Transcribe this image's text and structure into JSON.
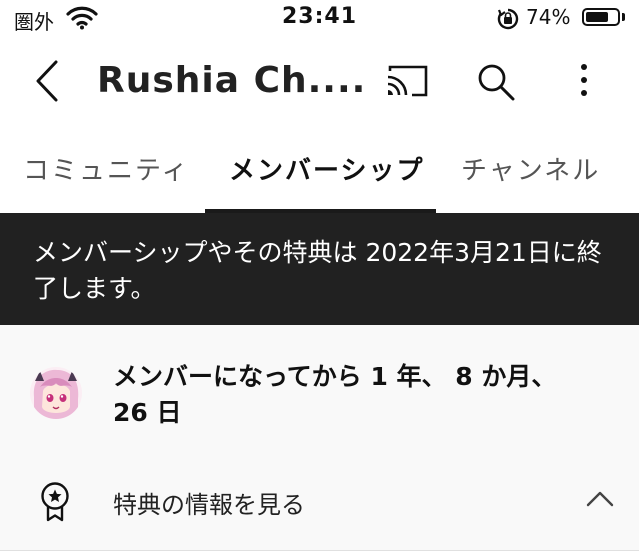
{
  "status_bar": {
    "carrier": "圏外",
    "time": "23:41",
    "battery_percent": "74%",
    "battery_level": 0.74
  },
  "header": {
    "title": "Rushia Ch....",
    "icons": [
      "back-chevron-icon",
      "cast-icon",
      "search-icon",
      "more-vert-icon"
    ]
  },
  "tabs": [
    {
      "label": "コミュニティ",
      "active": false
    },
    {
      "label": "メンバーシップ",
      "active": true
    },
    {
      "label": "チャンネル",
      "active": false
    }
  ],
  "banner": {
    "text": "メンバーシップやその特典は 2022年3月21日に終了します。"
  },
  "membership": {
    "duration": "メンバーになってから 1 年、 8 か月、 26 日",
    "benefits_label": "特典の情報を見る"
  },
  "colors": {
    "banner_bg": "#212121",
    "content_bg": "#f9f9f9",
    "active_tab_indicator": "#1a1a1a"
  }
}
